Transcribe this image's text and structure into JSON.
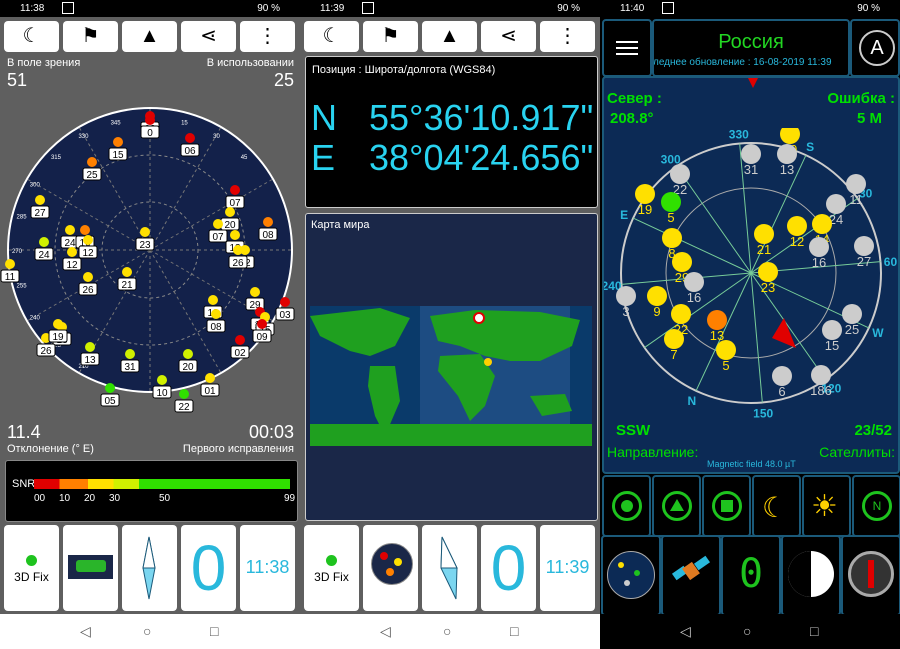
{
  "panel1": {
    "status_time": "11:38",
    "battery": "90 %",
    "toolbar": {
      "moon": "☾",
      "person": "⚑",
      "nav": "▲",
      "share": "⋖",
      "menu": "⋮"
    },
    "in_view_label": "В поле зрения",
    "in_view_value": "51",
    "in_use_label": "В использовании",
    "in_use_value": "25",
    "sky_ticks": [
      "345",
      "330",
      "315",
      "300",
      "285",
      "270",
      "255",
      "240",
      "225",
      "210",
      "15",
      "30",
      "45"
    ],
    "sats": [
      "08",
      "0",
      "15",
      "06",
      "25",
      "07",
      "27",
      "20",
      "07",
      "13",
      "24",
      "16",
      "12",
      "22",
      "26",
      "24",
      "12",
      "23",
      "08",
      "11",
      "21",
      "26",
      "13",
      "29",
      "19",
      "16",
      "03",
      "08",
      "15",
      "02",
      "09",
      "26",
      "13",
      "31",
      "20",
      "05",
      "10",
      "22",
      "01",
      "19"
    ],
    "deviation_value": "11.4",
    "deviation_label": "Отклонение (° E)",
    "ttf_value": "00:03",
    "ttf_label": "Первого исправления",
    "snr_label": "SNR",
    "snr_ticks": [
      "00",
      "10",
      "20",
      "30",
      "50",
      "99"
    ],
    "tile_fix": "3D Fix",
    "tile_speed": "0",
    "tile_time": "11:38"
  },
  "panel2": {
    "status_time": "11:39",
    "battery": "90 %",
    "position_label": "Позиция : Широта/долгота (WGS84)",
    "lat_dir": "N",
    "lat_value": "55°36'10.917\"",
    "lon_dir": "E",
    "lon_value": "38°04'24.656\"",
    "map_label": "Карта мира",
    "tile_fix": "3D Fix",
    "tile_speed": "0",
    "tile_time": "11:39"
  },
  "panel3": {
    "status_time": "11:40",
    "battery": "90 %",
    "country": "Россия",
    "last_update": "следнее обновление : 16-08-2019 11:39",
    "north_label": "Север :",
    "north_value": "208.8°",
    "error_label": "Ошибка :",
    "error_value": "5 M",
    "dir_code": "SSW",
    "sat_ratio": "23/52",
    "direction_label": "Направление:",
    "magnetic": "Magnetic field 48.0 µT",
    "sats_label": "Сателлиты:",
    "compass_marks": [
      "N",
      "S",
      "W",
      "E",
      "30",
      "60",
      "120",
      "150",
      "240",
      "300",
      "330"
    ],
    "sats": [
      "20",
      "13",
      "31",
      "22",
      "11",
      "19",
      "5",
      "24",
      "21",
      "12",
      "14",
      "16",
      "27",
      "8",
      "29",
      "3",
      "9",
      "16",
      "23",
      "22",
      "13",
      "25",
      "15",
      "7",
      "5",
      "6",
      "186"
    ],
    "seven_seg": "0"
  }
}
